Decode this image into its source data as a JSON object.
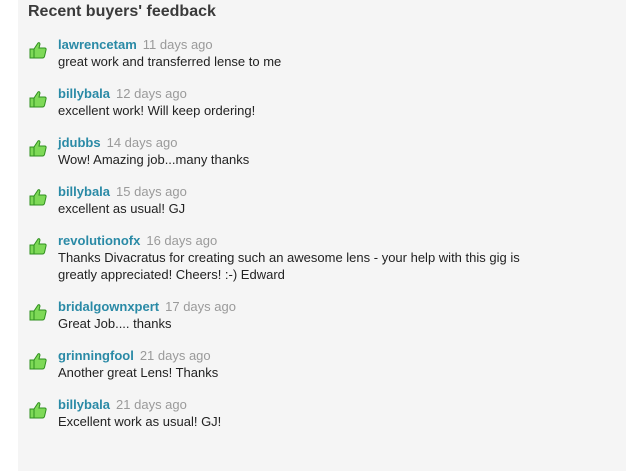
{
  "panel": {
    "title": "Recent buyers' feedback"
  },
  "feedback": [
    {
      "buyer": "lawrencetam",
      "time": "11 days ago",
      "comment": "great work and transferred lense to me"
    },
    {
      "buyer": "billybala",
      "time": "12 days ago",
      "comment": "excellent work! Will keep ordering!"
    },
    {
      "buyer": "jdubbs",
      "time": "14 days ago",
      "comment": "Wow! Amazing job...many thanks"
    },
    {
      "buyer": "billybala",
      "time": "15 days ago",
      "comment": "excellent as usual! GJ"
    },
    {
      "buyer": "revolutionofx",
      "time": "16 days ago",
      "comment": "Thanks Divacratus for creating such an awesome lens - your help with this gig is greatly appreciated! Cheers! :-) Edward"
    },
    {
      "buyer": "bridalgownxpert",
      "time": "17 days ago",
      "comment": "Great Job.... thanks"
    },
    {
      "buyer": "grinningfool",
      "time": "21 days ago",
      "comment": "Another great Lens! Thanks"
    },
    {
      "buyer": "billybala",
      "time": "21 days ago",
      "comment": "Excellent work as usual! GJ!"
    }
  ],
  "icons": {
    "thumb": "thumbs-up-icon"
  },
  "colors": {
    "buyer_link": "#2a8aa6",
    "time": "#9a9a9a",
    "thumb_fill": "#7ed957",
    "thumb_outline": "#2f8f1f"
  }
}
